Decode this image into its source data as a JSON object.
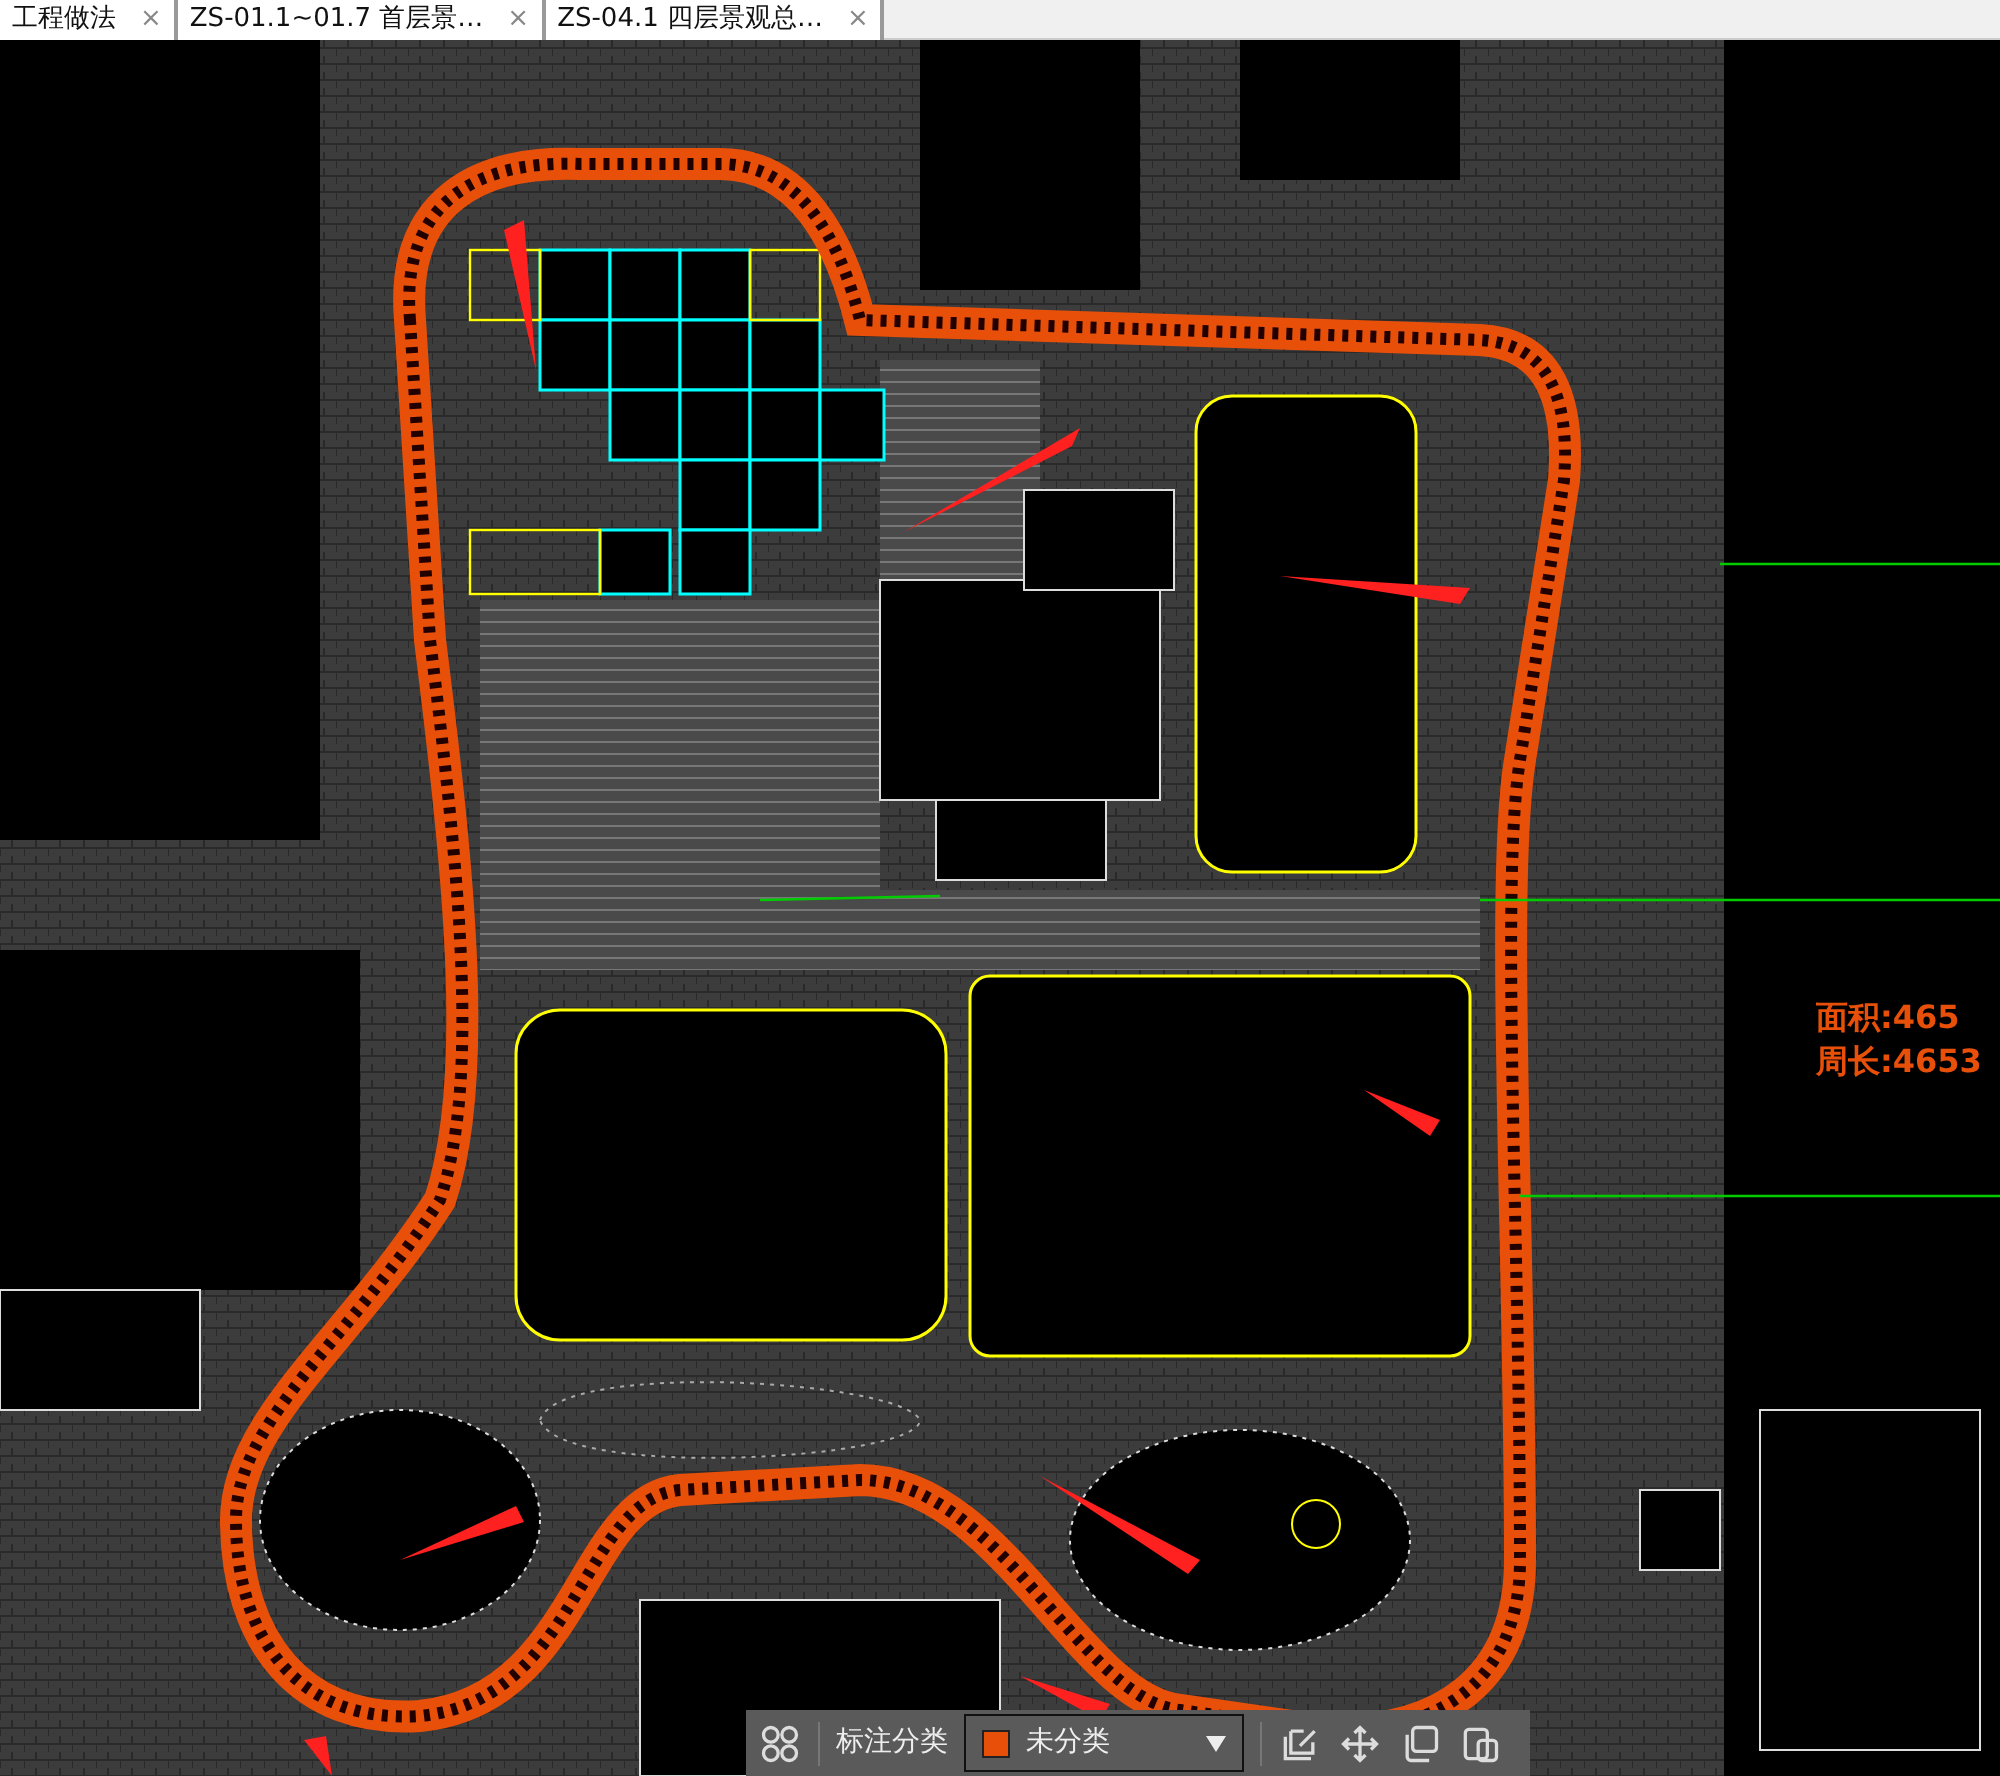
{
  "tabs": [
    {
      "label": "工程做法",
      "close": "×"
    },
    {
      "label": "ZS-01.1~01.7 首层景…",
      "close": "×"
    },
    {
      "label": "ZS-04.1 四层景观总…",
      "close": "×"
    }
  ],
  "canvas": {
    "measurements": [
      "面积:465",
      "周长:4653"
    ]
  },
  "toolbar": {
    "category_label": "标注分类",
    "category": {
      "value": "未分类",
      "color": "#e8500a"
    }
  }
}
